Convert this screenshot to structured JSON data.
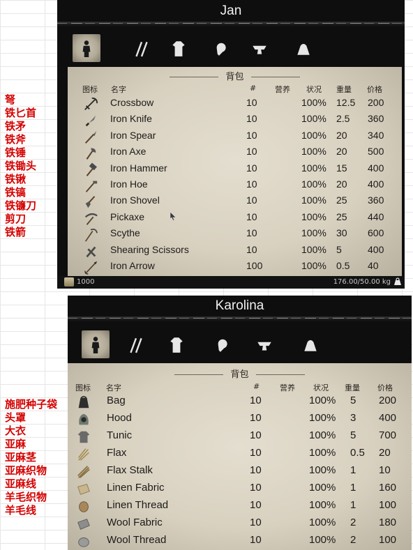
{
  "notes1": [
    "弩",
    "铁匕首",
    "铁矛",
    "铁斧",
    "铁锤",
    "铁锄头",
    "铁锹",
    "铁镐",
    "铁镰刀",
    "剪刀",
    "铁箭"
  ],
  "notes2": [
    "施肥种子袋",
    "头罩",
    "大衣",
    "亚麻",
    "亚麻茎",
    "亚麻织物",
    "亚麻线",
    "羊毛织物",
    "羊毛线"
  ],
  "panel1": {
    "name": "Jan",
    "section_title": "背包",
    "headers": {
      "icon": "图标",
      "name": "名字",
      "count": "#",
      "nutrition": "营养",
      "condition": "状况",
      "weight": "重量",
      "price": "价格"
    },
    "items": [
      {
        "icon": "crossbow-icon",
        "name": "Crossbow",
        "count": "10",
        "condition": "100%",
        "weight": "12.5",
        "price": "200"
      },
      {
        "icon": "knife-icon",
        "name": "Iron Knife",
        "count": "10",
        "condition": "100%",
        "weight": "2.5",
        "price": "360"
      },
      {
        "icon": "spear-icon",
        "name": "Iron Spear",
        "count": "10",
        "condition": "100%",
        "weight": "20",
        "price": "340"
      },
      {
        "icon": "axe-icon",
        "name": "Iron Axe",
        "count": "10",
        "condition": "100%",
        "weight": "20",
        "price": "500"
      },
      {
        "icon": "hammer-icon",
        "name": "Iron Hammer",
        "count": "10",
        "condition": "100%",
        "weight": "15",
        "price": "400"
      },
      {
        "icon": "hoe-icon",
        "name": "Iron Hoe",
        "count": "10",
        "condition": "100%",
        "weight": "20",
        "price": "400"
      },
      {
        "icon": "shovel-icon",
        "name": "Iron Shovel",
        "count": "10",
        "condition": "100%",
        "weight": "25",
        "price": "360"
      },
      {
        "icon": "pickaxe-icon",
        "name": "Pickaxe",
        "count": "10",
        "condition": "100%",
        "weight": "25",
        "price": "440"
      },
      {
        "icon": "scythe-icon",
        "name": "Scythe",
        "count": "10",
        "condition": "100%",
        "weight": "30",
        "price": "600"
      },
      {
        "icon": "scissors-icon",
        "name": "Shearing Scissors",
        "count": "10",
        "condition": "100%",
        "weight": "5",
        "price": "400"
      },
      {
        "icon": "arrow-icon",
        "name": "Iron Arrow",
        "count": "100",
        "condition": "100%",
        "weight": "0.5",
        "price": "40"
      }
    ],
    "coins": "1000",
    "carry_weight": "176.00/50.00 kg"
  },
  "panel2": {
    "name": "Karolina",
    "section_title": "背包",
    "headers": {
      "icon": "图标",
      "name": "名字",
      "count": "#",
      "nutrition": "营养",
      "condition": "状况",
      "weight": "重量",
      "price": "价格"
    },
    "items": [
      {
        "icon": "bag-icon",
        "name": "Bag",
        "count": "10",
        "condition": "100%",
        "weight": "5",
        "price": "200"
      },
      {
        "icon": "hood-icon",
        "name": "Hood",
        "count": "10",
        "condition": "100%",
        "weight": "3",
        "price": "400"
      },
      {
        "icon": "tunic-icon",
        "name": "Tunic",
        "count": "10",
        "condition": "100%",
        "weight": "5",
        "price": "700"
      },
      {
        "icon": "flax-icon",
        "name": "Flax",
        "count": "10",
        "condition": "100%",
        "weight": "0.5",
        "price": "20"
      },
      {
        "icon": "flax-stalk-icon",
        "name": "Flax Stalk",
        "count": "10",
        "condition": "100%",
        "weight": "1",
        "price": "10"
      },
      {
        "icon": "linen-fabric-icon",
        "name": "Linen Fabric",
        "count": "10",
        "condition": "100%",
        "weight": "1",
        "price": "160"
      },
      {
        "icon": "linen-thread-icon",
        "name": "Linen Thread",
        "count": "10",
        "condition": "100%",
        "weight": "1",
        "price": "100"
      },
      {
        "icon": "wool-fabric-icon",
        "name": "Wool Fabric",
        "count": "10",
        "condition": "100%",
        "weight": "2",
        "price": "180"
      },
      {
        "icon": "wool-thread-icon",
        "name": "Wool Thread",
        "count": "10",
        "condition": "100%",
        "weight": "2",
        "price": "100"
      }
    ]
  },
  "tabs": [
    "character-tab",
    "weapons-tab",
    "clothing-tab",
    "food-tab",
    "crafting-tab",
    "goods-tab"
  ],
  "colors": {
    "note_red": "#d40000",
    "panel_bg": "#0e0e0e",
    "parchment": "#ddd6c6",
    "text_dark": "#1c1a17"
  }
}
